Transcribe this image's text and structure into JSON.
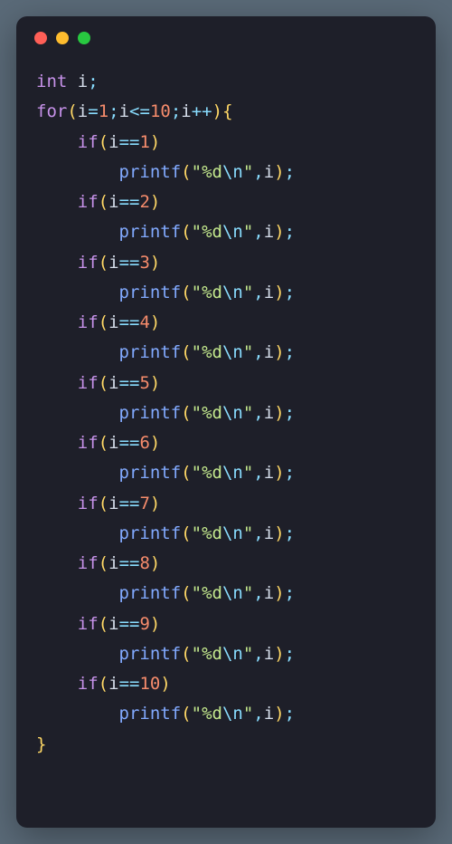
{
  "window": {
    "traffic_lights": [
      "close",
      "minimize",
      "maximize"
    ]
  },
  "code": {
    "indent_unit": "    ",
    "decl": {
      "kw": "int",
      "ident": "i",
      "semi": ";"
    },
    "for": {
      "kw": "for",
      "init": {
        "ident": "i",
        "op": "=",
        "num": "1"
      },
      "cond": {
        "ident": "i",
        "op": "<=",
        "num": "10"
      },
      "upd": {
        "ident": "i",
        "op": "++"
      },
      "brace_open": "{",
      "brace_close": "}"
    },
    "branches": [
      {
        "n": "1"
      },
      {
        "n": "2"
      },
      {
        "n": "3"
      },
      {
        "n": "4"
      },
      {
        "n": "5"
      },
      {
        "n": "6"
      },
      {
        "n": "7"
      },
      {
        "n": "8"
      },
      {
        "n": "9"
      },
      {
        "n": "10"
      }
    ],
    "if_kw": "if",
    "cmp_op": "==",
    "call": {
      "name": "printf",
      "quote": "\"",
      "str_body": "%d",
      "escape": "\\n",
      "comma": ",",
      "arg": "i",
      "semi": ";"
    }
  }
}
